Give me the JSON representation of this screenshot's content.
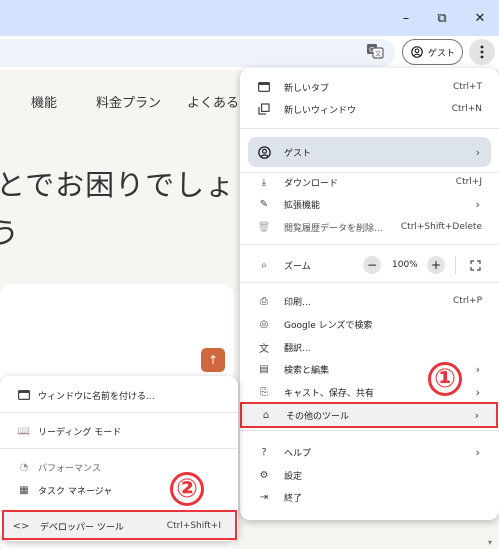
{
  "window": {
    "minimize_glyph": "–",
    "restore_glyph": "⧉",
    "close_glyph": "✕"
  },
  "toolbar": {
    "profile_label": "ゲスト"
  },
  "page": {
    "nav": [
      "機能",
      "料金プラン",
      "よくある質"
    ],
    "hero_line1": "とでお困りでしょ",
    "hero_line2": "う",
    "scroll_top_glyph": "↑"
  },
  "menu": {
    "new_tab": "新しいタブ",
    "new_tab_shortcut": "Ctrl+T",
    "new_window": "新しいウィンドウ",
    "new_window_shortcut": "Ctrl+N",
    "guest": "ゲスト",
    "downloads": "ダウンロード",
    "downloads_shortcut": "Ctrl+J",
    "extensions": "拡張機能",
    "clear_data": "閲覧履歴データを削除...",
    "clear_data_shortcut": "Ctrl+Shift+Delete",
    "zoom": "ズーム",
    "zoom_value": "100%",
    "print": "印刷...",
    "print_shortcut": "Ctrl+P",
    "google_lens": "Google レンズで検索",
    "translate": "翻訳...",
    "search_edit": "検索と編集",
    "cast_save_share": "キャスト、保存、共有",
    "more_tools": "その他のツール",
    "help": "ヘルプ",
    "settings": "設定",
    "exit": "終了"
  },
  "submenu": {
    "name_window": "ウィンドウに名前を付ける...",
    "reading_mode": "リーディング モード",
    "performance": "パフォーマンス",
    "task_manager": "タスク マネージャ",
    "devtools": "デベロッパー ツール",
    "devtools_shortcut": "Ctrl+Shift+I"
  },
  "annotations": {
    "badge1": "①",
    "badge2": "②"
  },
  "colors": {
    "titlebar": "#d3e3fd",
    "highlight": "#e8343a",
    "accent_button": "#d0683f"
  }
}
